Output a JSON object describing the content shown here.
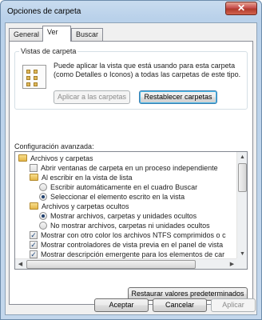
{
  "window": {
    "title": "Opciones de carpeta",
    "close_glyph": "✕"
  },
  "tabs": [
    {
      "label": "General",
      "active": false
    },
    {
      "label": "Ver",
      "active": true
    },
    {
      "label": "Buscar",
      "active": false
    }
  ],
  "folder_views": {
    "group_title": "Vistas de carpeta",
    "description": "Puede aplicar la vista que está usando para esta carpeta (como Detalles o Iconos) a todas las carpetas de este tipo.",
    "apply_button": "Aplicar a las carpetas",
    "reset_button": "Restablecer carpetas"
  },
  "advanced": {
    "label": "Configuración avanzada:",
    "items": [
      {
        "kind": "folder",
        "level": 0,
        "text": "Archivos y carpetas"
      },
      {
        "kind": "checkbox",
        "level": 1,
        "checked": false,
        "text": "Abrir ventanas de carpeta  en un proceso independiente"
      },
      {
        "kind": "folder",
        "level": 1,
        "text": "Al escribir en la vista de lista"
      },
      {
        "kind": "radio",
        "level": 2,
        "checked": false,
        "text": "Escribir automáticamente en el cuadro Buscar"
      },
      {
        "kind": "radio",
        "level": 2,
        "checked": true,
        "text": "Seleccionar el elemento escrito en la vista"
      },
      {
        "kind": "folder",
        "level": 1,
        "text": "Archivos y carpetas ocultos"
      },
      {
        "kind": "radio",
        "level": 2,
        "checked": true,
        "text": "Mostrar archivos, carpetas y unidades ocultos"
      },
      {
        "kind": "radio",
        "level": 2,
        "checked": false,
        "text": "No mostrar archivos, carpetas ni unidades ocultos"
      },
      {
        "kind": "checkbox",
        "level": 1,
        "checked": true,
        "text": "Mostrar con otro color los archivos NTFS comprimidos o c"
      },
      {
        "kind": "checkbox",
        "level": 1,
        "checked": true,
        "text": "Mostrar controladores de vista previa en el panel de vista"
      },
      {
        "kind": "checkbox",
        "level": 1,
        "checked": true,
        "text": "Mostrar descripción emergente para los elementos de car"
      }
    ],
    "restore_button": "Restaurar valores predeterminados"
  },
  "footer": {
    "ok": "Aceptar",
    "cancel": "Cancelar",
    "apply": "Aplicar"
  },
  "colors": {
    "accent": "#3c7fb1",
    "titlebar": "#b9d1ea",
    "close": "#c75050"
  }
}
